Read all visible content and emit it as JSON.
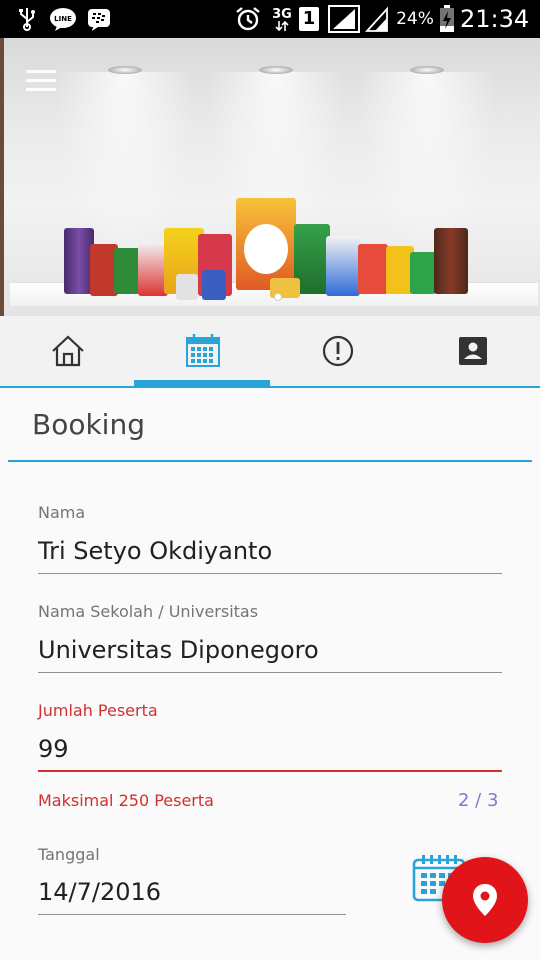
{
  "status_bar": {
    "network": "3G",
    "sim": "1",
    "battery": "24%",
    "time": "21:34"
  },
  "hero": {
    "pager_pages": 1
  },
  "tabs": [
    {
      "name": "home-icon",
      "active": false
    },
    {
      "name": "calendar-icon",
      "active": true
    },
    {
      "name": "alert-icon",
      "active": false
    },
    {
      "name": "contact-icon",
      "active": false
    }
  ],
  "page": {
    "title": "Booking"
  },
  "form": {
    "nama": {
      "label": "Nama",
      "value": "Tri Setyo Okdiyanto"
    },
    "sekolah": {
      "label": "Nama Sekolah / Universitas",
      "value": "Universitas Diponegoro"
    },
    "jumlah": {
      "label": "Jumlah Peserta",
      "value": "99",
      "error": "Maksimal 250 Peserta",
      "counter": "2 / 3"
    },
    "tanggal": {
      "label": "Tanggal",
      "value": "14/7/2016"
    }
  },
  "colors": {
    "accent": "#29a4d9",
    "error": "#d32f2f",
    "fab": "#e1141a",
    "counter": "#7e7cc9"
  },
  "fab": {
    "icon": "map-pin-icon"
  }
}
